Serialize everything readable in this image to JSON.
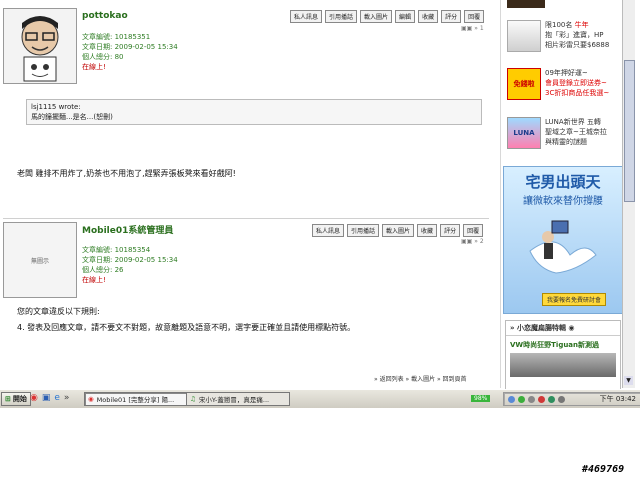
{
  "post1": {
    "username": "pottokao",
    "toolbar": [
      "私人訊息",
      "引用播話",
      "載入圖片",
      "編輯",
      "收藏",
      "評分",
      "回覆"
    ],
    "page_indicator": "» 1",
    "meta": {
      "views": "文章編號: 10185351",
      "date": "文章日期: 2009-02-05 15:34",
      "score": "個人總分: 80",
      "online": "在線上!"
    },
    "quote": {
      "author": "lsj1115 wrote:",
      "text": "馬的鐘擺麵...是名...(恕刪)"
    },
    "body": "老闆 雞排不用炸了,奶茶也不用泡了,趕緊弄張板凳來看好戲阿!"
  },
  "post2": {
    "username": "Mobile01系統管理員",
    "toolbar": [
      "私人訊息",
      "引用播話",
      "載入圖片",
      "收藏",
      "評分",
      "回覆"
    ],
    "page_indicator": "» 2",
    "avatar_placeholder": "無圖示",
    "meta": {
      "views": "文章編號: 10185354",
      "date": "文章日期: 2009-02-05 15:34",
      "score": "個人總分: 26",
      "online": "在線上!"
    },
    "body_line1": "您的文章違反以下規則:",
    "body_line2": "4. 發表及回應文章，請不要文不對題，故意離題及語意不明，選字要正確並且請使用標點符號。"
  },
  "footer_links": "» 返回列表 » 載入圖片 » 回到頁首",
  "sidebar": {
    "ads": [
      {
        "line1": "限100名 ",
        "line1_hl": "牛年",
        "line2": "抱「彩」進寶，HP",
        "line3": "相片彩雷只要$6888"
      },
      {
        "line1": "09年押好運~",
        "line2": "會員登錄立即送券~",
        "line3": "3C折扣商品任我選~"
      },
      {
        "line1": "LUNA新世界 五轉",
        "line2": "聖域之章~王城奈拉",
        "line3": "與精靈的謎題"
      }
    ],
    "ad_badges": [
      "免錢啦",
      "LUNA"
    ],
    "banner": {
      "title": "宅男出頭天",
      "subtitle": "讓微軟來替你撐腰",
      "button": "我要報名免費研討會"
    },
    "box_title": "» 小恋魔扁腸特輯 ",
    "box_item": "VW時尚狂野Tiguan新測過"
  },
  "taskbar": {
    "start": "開始",
    "tasks": [
      "Mobile01 [完整分享] 陽...",
      "宋小Y-蓋戀冒，真是痛..."
    ],
    "cpu": "98%",
    "clock": "下午 03:42"
  },
  "watermark": "#469769",
  "colors": {
    "accent_green": "#2a6f1e",
    "online_red": "#c00000",
    "taskbar": "#d8d5cc"
  }
}
